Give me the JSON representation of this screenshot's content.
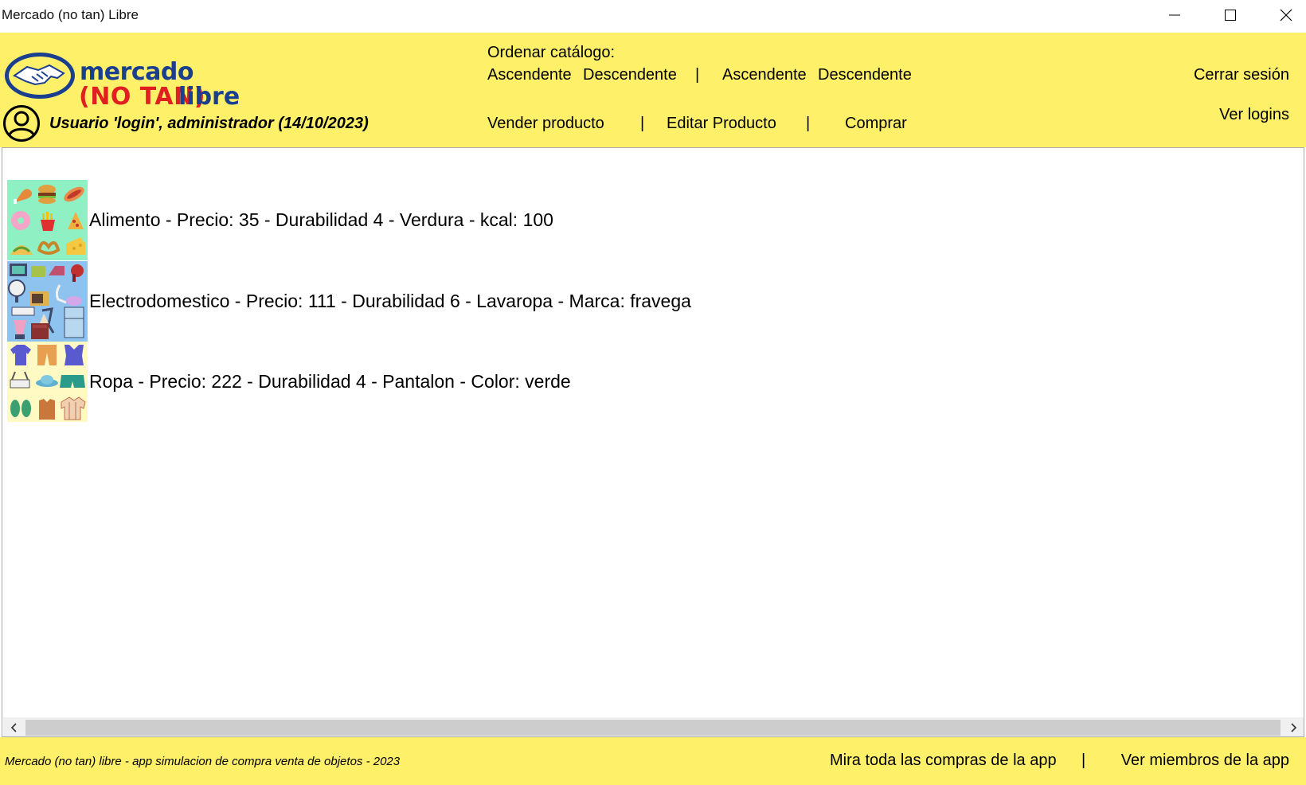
{
  "window": {
    "title": "Mercado (no tan) Libre"
  },
  "logo": {
    "line1": "mercado",
    "line2": "(NO TAN)",
    "line3": "libre"
  },
  "user": {
    "label": "Usuario 'login', administrador (14/10/2023)"
  },
  "sort": {
    "label": "Ordenar catálogo:",
    "asc1": "Ascendente",
    "desc1": "Descendente",
    "separator": "|",
    "asc2": "Ascendente",
    "desc2": "Descendente"
  },
  "actions": {
    "sell": "Vender producto",
    "edit": "Editar Producto",
    "buy": "Comprar",
    "separator": "|"
  },
  "right_links": {
    "logout": "Cerrar sesión",
    "logins": "Ver logins"
  },
  "products": [
    {
      "category": "alimento",
      "text": "Alimento - Precio: 35 - Durabilidad 4 - Verdura - kcal: 100"
    },
    {
      "category": "electrodomestico",
      "text": "Electrodomestico - Precio: 111 - Durabilidad 6 - Lavaropa - Marca: fravega"
    },
    {
      "category": "ropa",
      "text": "Ropa - Precio: 222 - Durabilidad 4 - Pantalon - Color: verde"
    }
  ],
  "footer": {
    "caption": "Mercado (no tan) libre - app simulacion de compra venta de objetos - 2023",
    "all_purchases": "Mira toda las compras de la app",
    "separator": "|",
    "members": "Ver miembros de la app"
  },
  "colors": {
    "header_bg": "#fff06a",
    "logo_blue": "#1a3f8f",
    "logo_red": "#e02020"
  }
}
